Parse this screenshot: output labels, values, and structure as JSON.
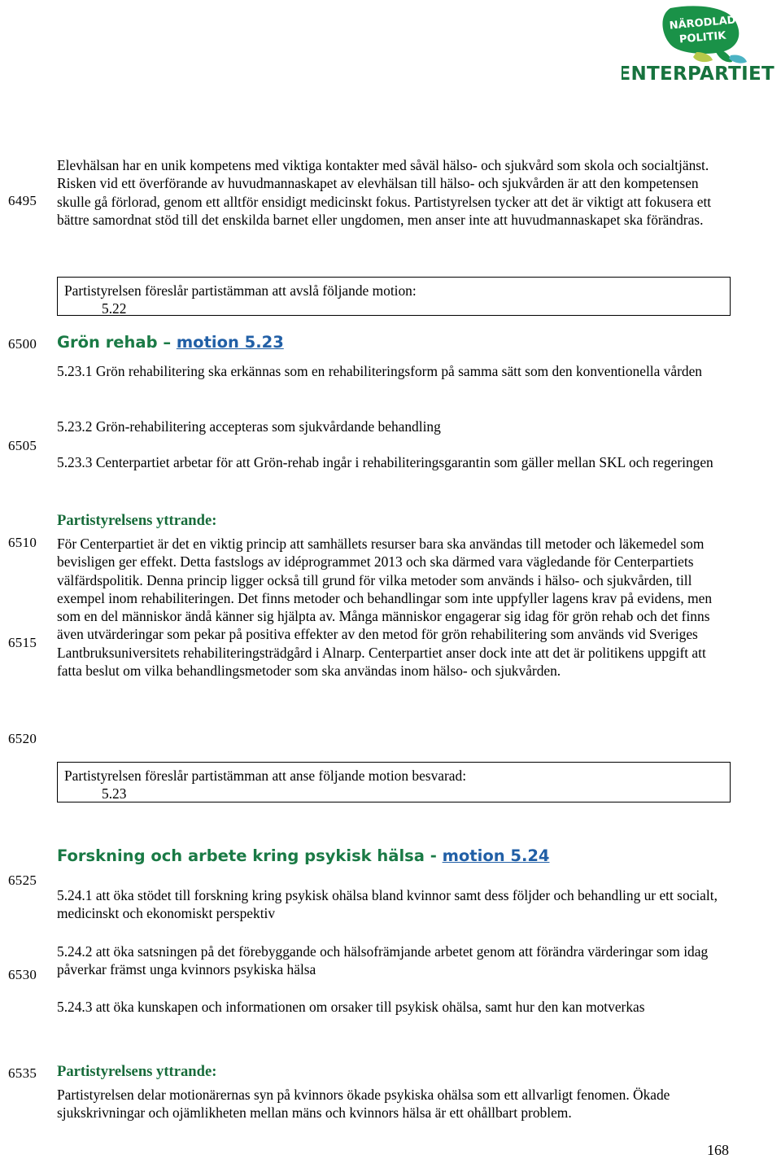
{
  "logo": {
    "bubble_line1": "NÄRODLAD",
    "bubble_line2": "POLITIK",
    "wordmark": "CENTERPARTIET",
    "green": "#1a9248",
    "dark_green": "#17733e"
  },
  "colors": {
    "heading_green": "#1a7a45",
    "link_blue": "#215fa6",
    "yttrande_green": "#176b3a",
    "text_black": "#000000"
  },
  "line_numbers": [
    "6495",
    "6500",
    "6505",
    "6510",
    "6515",
    "6520",
    "6525",
    "6530",
    "6535"
  ],
  "paragraphs": {
    "intro": "Elevhälsan har en unik kompetens med viktiga kontakter med såväl hälso- och sjukvård som skola och socialtjänst. Risken vid ett överförande av huvudmannaskapet av elevhälsan till hälso- och sjukvården är att den kompetensen skulle gå förlorad, genom ett alltför ensidigt medicinskt fokus. Partistyrelsen tycker att det är viktigt att fokusera ett bättre samordnat stöd till det enskilda barnet eller ungdomen, men anser inte att huvudmannaskapet ska förändras.",
    "gron_rehab_yttrande_body": "För Centerpartiet är det en viktig princip att samhällets resurser bara ska användas till metoder och läkemedel som bevisligen ger effekt. Detta fastslogs av idéprogrammet 2013 och ska därmed vara vägledande för Centerpartiets välfärdspolitik. Denna princip ligger också till grund för vilka metoder som används i hälso- och sjukvården, till exempel inom rehabiliteringen. Det finns metoder och behandlingar som inte uppfyller lagens krav på evidens, men som en del människor ändå känner sig hjälpta av. Många människor engagerar sig idag för grön rehab och det finns även utvärderingar som pekar på positiva effekter av den metod för grön rehabilitering som används vid Sveriges Lantbruksuniversitets rehabiliteringsträdgård i Alnarp. Centerpartiet anser dock inte att det är politikens uppgift att fatta beslut om vilka behandlingsmetoder som ska användas inom hälso- och sjukvården.",
    "psykisk_halsa_yttrande_body": "Partistyrelsen delar motionärernas syn på kvinnors ökade psykiska ohälsa som ett allvarligt fenomen. Ökade sjukskrivningar och ojämlikheten mellan mäns och kvinnors hälsa är ett ohållbart problem."
  },
  "box_5_22": {
    "line1": "Partistyrelsen föreslår partistämman att avslå följande motion:",
    "line2": "5.22"
  },
  "box_5_23": {
    "line1": "Partistyrelsen föreslår partistämman att anse följande motion besvarad:",
    "line2": "5.23"
  },
  "heading_5_23": {
    "title": "Grön rehab – ",
    "link": "motion 5.23"
  },
  "heading_5_24": {
    "title": "Forskning och arbete kring psykisk hälsa - ",
    "link": "motion 5.24"
  },
  "motion_5_23_items": {
    "item1": "5.23.1 Grön rehabilitering ska erkännas som en rehabiliteringsform på samma sätt som den konventionella vården",
    "item2": "5.23.2 Grön-rehabilitering accepteras som sjukvårdande behandling",
    "item3": "5.23.3 Centerpartiet arbetar för att Grön-rehab ingår i rehabiliteringsgarantin som gäller mellan SKL och regeringen"
  },
  "motion_5_24_items": {
    "item1": "5.24.1 att öka stödet till forskning kring psykisk ohälsa bland kvinnor samt dess följder och behandling ur ett socialt, medicinskt och ekonomiskt perspektiv",
    "item2": "5.24.2 att öka satsningen på det förebyggande och hälsofrämjande arbetet genom att förändra värderingar som idag påverkar främst unga kvinnors psykiska hälsa",
    "item3": "5.24.3 att öka kunskapen och informationen om orsaker till psykisk ohälsa, samt hur den kan motverkas"
  },
  "yttrande_label": "Partistyrelsens yttrande:",
  "page_number": "168"
}
